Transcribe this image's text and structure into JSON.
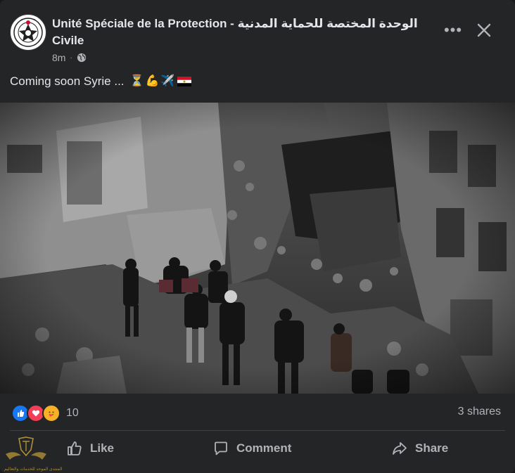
{
  "post": {
    "page_name": "Unité Spéciale de la Protection - الوحدة المختصة للحماية المدنية Civile",
    "time": "8m",
    "text": "Coming soon Syrie ...",
    "emojis": [
      "⏳",
      "💪",
      "✈️"
    ],
    "flag_icon": "egypt-flag-icon",
    "photo_icon": "earthquake-rubble-rescue-photo"
  },
  "engagement": {
    "reaction_icons": [
      "like-icon",
      "love-icon",
      "care-icon"
    ],
    "reaction_count": "10",
    "shares": "3 shares"
  },
  "actions": {
    "like": "Like",
    "comment": "Comment",
    "share": "Share"
  },
  "watermark": {
    "text": "المنتدى الموحد للخدمات والتعاليم"
  },
  "colors": {
    "card": "#242526",
    "text_primary": "#e4e6eb",
    "text_secondary": "#b0b3b8",
    "like_blue": "#1877f2",
    "love_red": "#f33e58",
    "care_yellow": "#f7b125"
  }
}
